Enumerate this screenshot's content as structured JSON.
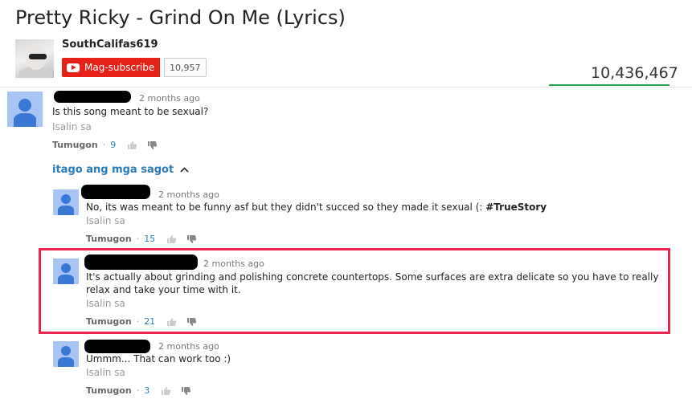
{
  "video": {
    "title": "Pretty Ricky - Grind On Me (Lyrics)",
    "channel": "SouthCalifas619",
    "subscribe_label": "Mag-subscribe",
    "subscriber_count": "10,957",
    "view_count": "10,436,467"
  },
  "comments": [
    {
      "time": "2 months ago",
      "text": "Is this song meant to be sexual?",
      "translate": "Isalin sa",
      "reply_label": "Tumugon",
      "dot": "·",
      "likes": "9"
    }
  ],
  "hide_replies_label": "itago ang mga sagot",
  "replies": [
    {
      "time": "2 months ago",
      "text": "No, its was meant to be funny asf but they didn't succed so they made it sexual (: ",
      "hashtag": "#TrueStory",
      "translate": "Isalin sa",
      "reply_label": "Tumugon",
      "dot": "·",
      "likes": "15"
    },
    {
      "time": "2 months ago",
      "text": "It's actually about grinding and polishing concrete countertops. Some surfaces are extra delicate so you have to really relax and take your time with it.",
      "translate": "Isalin sa",
      "reply_label": "Tumugon",
      "dot": "·",
      "likes": "21",
      "highlighted": true
    },
    {
      "time": "2 months ago",
      "text": "Ummm... That can work too :)",
      "translate": "Isalin sa",
      "reply_label": "Tumugon",
      "dot": "·",
      "likes": "3"
    }
  ],
  "colors": {
    "subscribe_red": "#e62117",
    "link_blue": "#2b7bb9",
    "highlight_border": "#e8264f",
    "avatar_bg": "#a8c4f2",
    "avatar_fg": "#3b78d6"
  },
  "icons": [
    "youtube-logo-icon",
    "thumbs-up-icon",
    "thumbs-down-icon",
    "chevron-up-icon",
    "default-avatar-icon"
  ]
}
